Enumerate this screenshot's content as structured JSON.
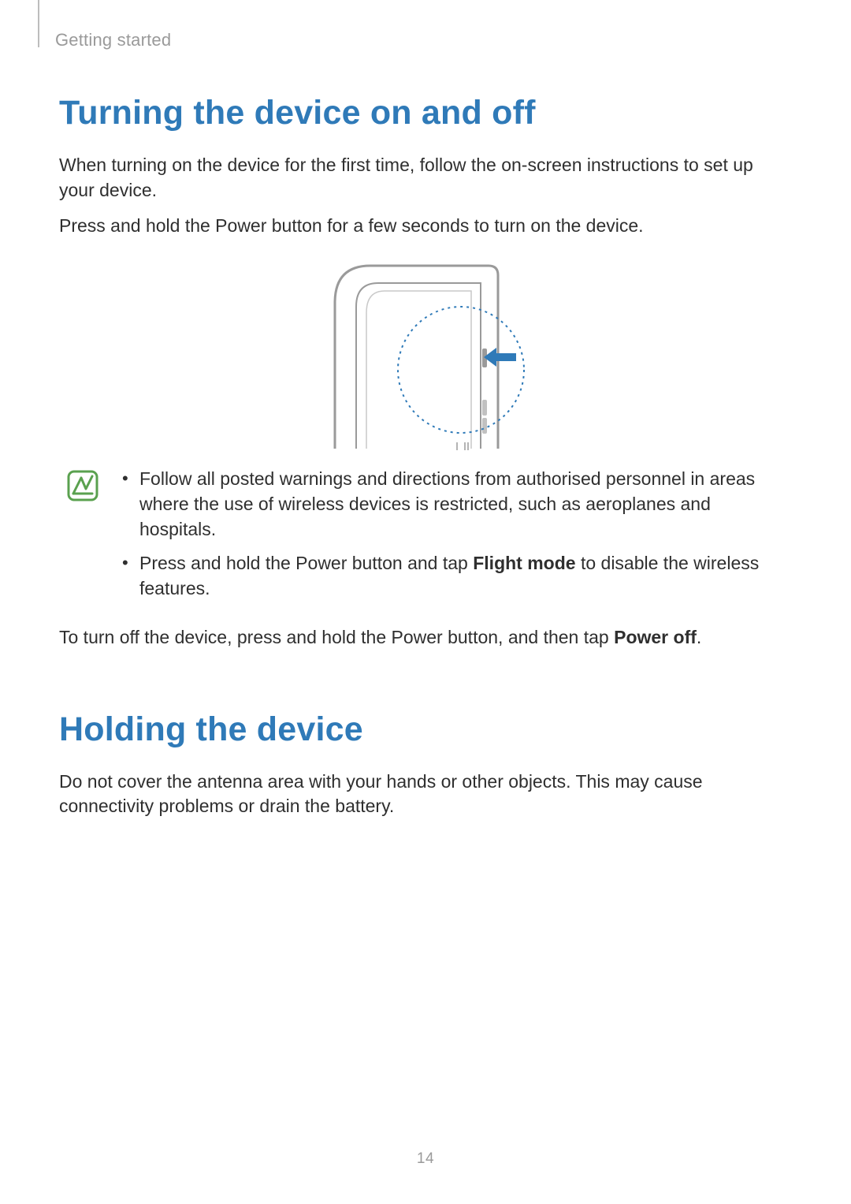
{
  "chapter": "Getting started",
  "page_number": "14",
  "section1": {
    "heading": "Turning the device on and off",
    "para1": "When turning on the device for the first time, follow the on-screen instructions to set up your device.",
    "para2": "Press and hold the Power button for a few seconds to turn on the device.",
    "note_bullets": [
      {
        "text": "Follow all posted warnings and directions from authorised personnel in areas where the use of wireless devices is restricted, such as aeroplanes and hospitals."
      },
      {
        "prefix": "Press and hold the Power button and tap ",
        "bold": "Flight mode",
        "suffix": " to disable the wireless features."
      }
    ],
    "para3_prefix": "To turn off the device, press and hold the Power button, and then tap ",
    "para3_bold": "Power off",
    "para3_suffix": "."
  },
  "section2": {
    "heading": "Holding the device",
    "para1": "Do not cover the antenna area with your hands or other objects. This may cause connectivity problems or drain the battery."
  }
}
